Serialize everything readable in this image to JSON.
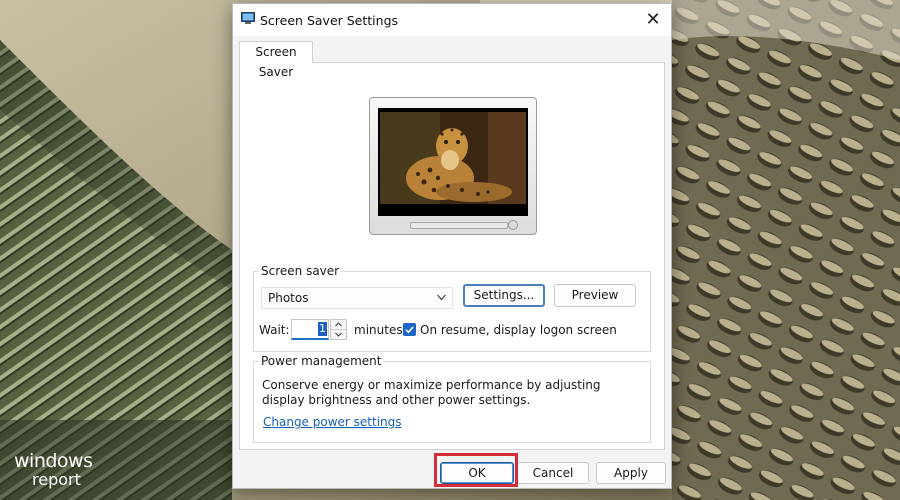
{
  "dialog": {
    "title": "Screen Saver Settings",
    "close_symbol": "✕",
    "tab_label": "Screen Saver"
  },
  "screen_saver": {
    "group_label": "Screen saver",
    "selected": "Photos",
    "settings_label": "Settings...",
    "preview_label": "Preview",
    "wait_label": "Wait:",
    "wait_value": "1",
    "minutes_label": "minutes",
    "resume_checked": true,
    "resume_label": "On resume, display logon screen"
  },
  "power": {
    "group_label": "Power management",
    "description": "Conserve energy or maximize performance by adjusting display brightness and other power settings.",
    "link_label": "Change power settings"
  },
  "buttons": {
    "ok": "OK",
    "cancel": "Cancel",
    "apply": "Apply"
  },
  "watermark": {
    "line1": "windows",
    "line2": "report"
  },
  "colors": {
    "accent": "#1e66c4",
    "highlight": "#d12e3a",
    "link": "#1560b6"
  },
  "icons": [
    "screen-saver-app-icon",
    "close-icon",
    "chevron-down-icon",
    "spin-up-icon",
    "spin-down-icon",
    "checkmark-icon"
  ]
}
